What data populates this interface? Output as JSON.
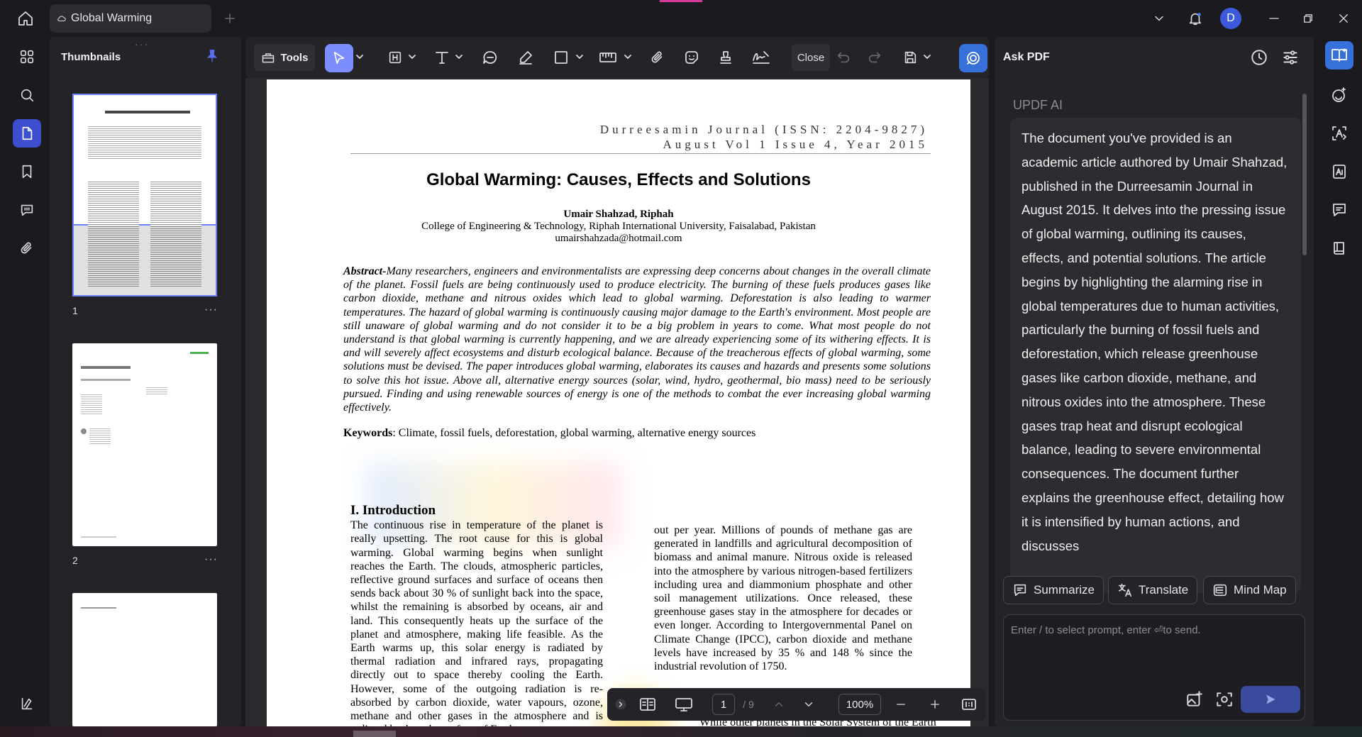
{
  "window": {
    "tab_title": "Global Warming",
    "avatar_letter": "D",
    "accent": "#3b4fcf"
  },
  "left_rail": {
    "items": [
      "grid-icon",
      "search-icon",
      "page-icon",
      "bookmark-icon",
      "comment-icon",
      "attachment-icon"
    ],
    "bottom": "settings-icon"
  },
  "thumbnails": {
    "title": "Thumbnails",
    "pages": [
      {
        "number": "1",
        "more": "···"
      },
      {
        "number": "2",
        "more": "···"
      }
    ]
  },
  "toolbar": {
    "tools_label": "Tools",
    "close_label": "Close",
    "icons": [
      "select-icon",
      "text-box-icon",
      "text-icon",
      "comment-icon",
      "highlight-icon",
      "shape-icon",
      "ruler-icon",
      "attach-icon",
      "sticker-icon",
      "stamp-icon",
      "signature-icon",
      "undo-icon",
      "redo-icon",
      "save-icon",
      "ai-assistant-icon"
    ]
  },
  "document": {
    "journal_line1": "Durreesamin Journal (ISSN: 2204-9827)",
    "journal_line2": "August Vol 1 Issue 4, Year 2015",
    "title": "Global Warming: Causes, Effects and Solutions",
    "author": "Umair Shahzad, Riphah",
    "affiliation": "College of Engineering & Technology, Riphah International University, Faisalabad, Pakistan",
    "email": "umairshahzada@hotmail.com",
    "abstract_label": "Abstract-",
    "abstract_text": "Many researchers, engineers and environmentalists are expressing deep concerns about changes in the overall climate of the planet. Fossil fuels are being continuously used to produce electricity. The burning of these fuels produces gases like carbon dioxide, methane and nitrous oxides which lead to global warming. Deforestation is also leading to warmer temperatures. The hazard of global warming is continuously causing major damage to the Earth's environment. Most people are still unaware of global warming and do not consider it to be a big problem in years to come. What most people do not understand is that global warming is currently happening, and we are already experiencing some of its withering effects. It is and will severely affect ecosystems and disturb ecological balance. Because of the treacherous effects of global warming, some solutions must be devised. The paper introduces global warming, elaborates its causes and hazards and presents some solutions to solve this hot issue. Above all, alternative energy sources (solar, wind, hydro, geothermal, bio mass) need to be seriously pursued. Finding and using renewable sources of energy is one of the methods to combat the ever increasing global warming effectively.",
    "keywords_label": "Keywords",
    "keywords_text": ": Climate, fossil fuels, deforestation, global warming, alternative energy sources",
    "intro_heading": "I. Introduction",
    "intro_text": "The continuous rise in temperature of the planet is really upsetting. The root cause for this is global warming.  Global warming begins when sunlight reaches the Earth. The clouds, atmospheric particles, reflective ground surfaces and surface of oceans then sends back about 30 % of sunlight back into the space, whilst the remaining is absorbed by oceans, air and land. This consequently heats up the surface of the planet and atmosphere, making life feasible. As the Earth warms up, this solar energy is radiated by thermal radiation and infrared rays, propagating directly out to space thereby cooling the Earth. However, some of the outgoing radiation is re-absorbed by carbon dioxide, water vapours, ozone, methane and other gases in the atmosphere and is radiated back to the surface of Earth.",
    "right_col_text": "out per year. Millions of pounds of methane gas are generated in landfills and agricultural decomposition of biomass and animal manure. Nitrous oxide is released into the atmosphere by various nitrogen-based fertilizers including urea and diammonium phosphate and other soil management utilizations. Once released, these greenhouse gases stay in the atmosphere for decades or even longer. According to Intergovernmental Panel on Climate Change (IPCC), carbon dioxide and methane levels have increased by 35 % and 148 % since the industrial revolution of 1750.",
    "right_col_tail": "While other planets in the Solar System of the Earth"
  },
  "page_nav": {
    "current_page": "1",
    "total_pages": "/ 9",
    "zoom": "100%"
  },
  "ai_panel": {
    "title": "Ask PDF",
    "label": "UPDF AI",
    "message": "The document you've provided is an academic article authored by Umair Shahzad, published in the Durreesamin Journal in August 2015. It delves into the pressing issue of global warming, outlining its causes, effects, and potential solutions. The article begins by highlighting the alarming rise in global temperatures due to human activities, particularly the burning of fossil fuels and deforestation, which release greenhouse gases like carbon dioxide, methane, and nitrous oxides into the atmosphere. These gases trap heat and disrupt ecological balance, leading to severe environmental consequences. The document further explains the greenhouse effect, detailing how it is intensified by human actions, and discusses",
    "summarize_label": "Summarize",
    "translate_label": "Translate",
    "mindmap_label": "Mind Map",
    "prompt_placeholder": "Enter / to select prompt, enter ⏎to send."
  }
}
